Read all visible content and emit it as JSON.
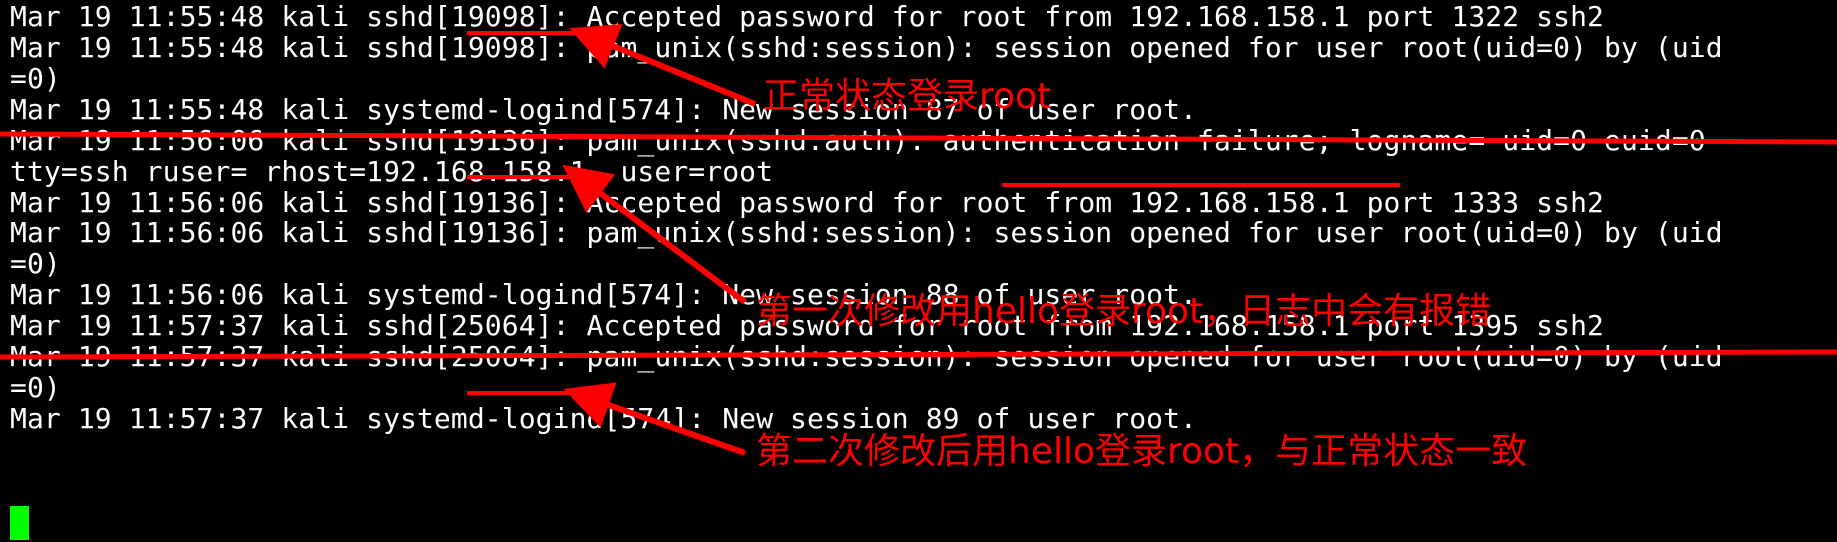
{
  "terminal": {
    "lines": [
      "Mar 19 11:55:48 kali sshd[19098]: Accepted password for root from 192.168.158.1 port 1322 ssh2",
      "Mar 19 11:55:48 kali sshd[19098]: pam_unix(sshd:session): session opened for user root(uid=0) by (uid",
      "=0)",
      "Mar 19 11:55:48 kali systemd-logind[574]: New session 87 of user root.",
      "Mar 19 11:56:06 kali sshd[19136]: pam_unix(sshd:auth): authentication failure; logname= uid=0 euid=0",
      "tty=ssh ruser= rhost=192.168.158.1  user=root",
      "Mar 19 11:56:06 kali sshd[19136]: Accepted password for root from 192.168.158.1 port 1333 ssh2",
      "Mar 19 11:56:06 kali sshd[19136]: pam_unix(sshd:session): session opened for user root(uid=0) by (uid",
      "=0)",
      "Mar 19 11:56:06 kali systemd-logind[574]: New session 88 of user root.",
      "Mar 19 11:57:37 kali sshd[25064]: Accepted password for root from 192.168.158.1 port 1395 ssh2",
      "Mar 19 11:57:37 kali sshd[25064]: pam_unix(sshd:session): session opened for user root(uid=0) by (uid",
      "=0)",
      "Mar 19 11:57:37 kali systemd-logind[574]: New session 89 of user root."
    ],
    "colors": {
      "background": "#000000",
      "text": "#ffffff",
      "cursor": "#00ff00"
    }
  },
  "annotations": {
    "color": "#ff0000",
    "notes": [
      "正常状态登录root",
      "第一次修改用hello登录root，日志中会有报错",
      "第二次修改后用hello登录root，与正常状态一致"
    ]
  }
}
